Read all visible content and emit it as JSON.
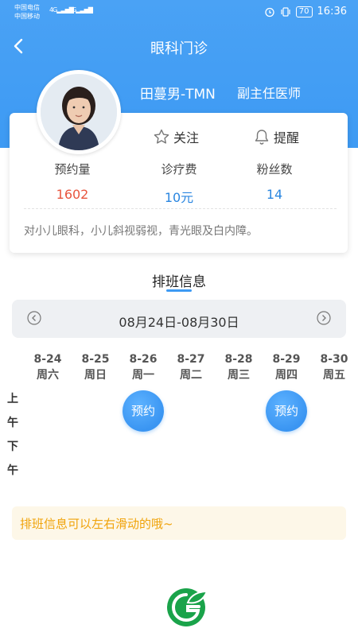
{
  "status_bar": {
    "carrier1": "中国电信",
    "carrier2": "中国移动",
    "net1": "4G",
    "net2": "2G",
    "battery": "70",
    "time": "16:36"
  },
  "nav": {
    "title": "眼科门诊",
    "back_icon": "chevron-left-icon"
  },
  "doctor": {
    "name": "田蔓男-TMN",
    "title": "副主任医师",
    "follow_label": "关注",
    "remind_label": "提醒",
    "stats": [
      {
        "label": "预约量",
        "value": "1602",
        "color": "#e8553e"
      },
      {
        "label": "诊疗费",
        "value": "10元",
        "color": "#2a86e0"
      },
      {
        "label": "粉丝数",
        "value": "14",
        "color": "#2a86e0"
      }
    ],
    "description": "对小儿眼科，小儿斜视弱视，青光眼及白内障。"
  },
  "schedule": {
    "title": "排班信息",
    "week_range": "08月24日-08月30日",
    "days": [
      {
        "date": "8-24",
        "weekday": "周六"
      },
      {
        "date": "8-25",
        "weekday": "周日"
      },
      {
        "date": "8-26",
        "weekday": "周一"
      },
      {
        "date": "8-27",
        "weekday": "周二"
      },
      {
        "date": "8-28",
        "weekday": "周三"
      },
      {
        "date": "8-29",
        "weekday": "周四"
      },
      {
        "date": "8-30",
        "weekday": "周五"
      }
    ],
    "periods": {
      "am1": "上",
      "am2": "午",
      "pm1": "下",
      "pm2": "午"
    },
    "book_label": "预约",
    "tip": "排班信息可以左右滑动的哦~"
  },
  "colors": {
    "primary": "#3d9af3",
    "tip_text": "#f0a30a",
    "logo_green": "#1aa34a"
  }
}
